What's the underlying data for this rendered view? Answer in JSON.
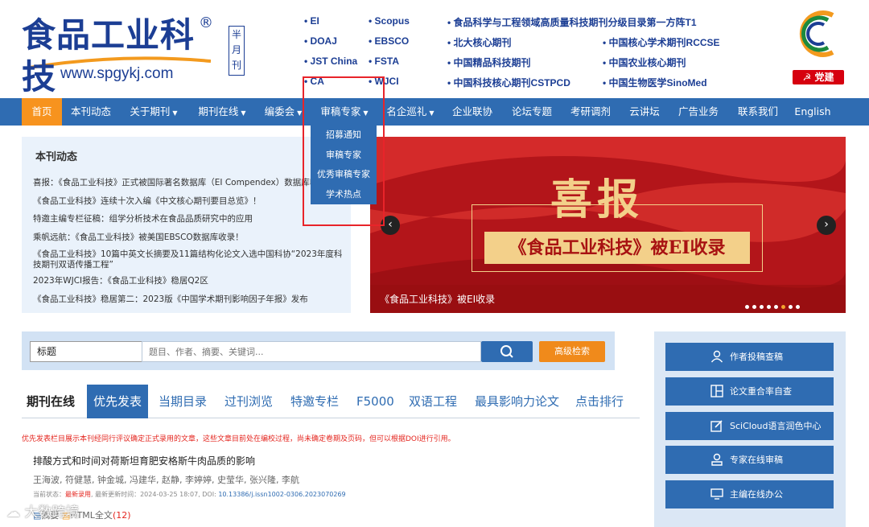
{
  "header": {
    "logo_cn": "食品工业科技",
    "logo_reg": "®",
    "logo_url": "www.spgykj.com",
    "frequency": "半月刊",
    "indexes": [
      "EI",
      "Scopus",
      "食品科学与工程领域高质量科技期刊分级目录第一方阵T1",
      "DOAJ",
      "EBSCO",
      "北大核心期刊",
      "中国核心学术期刊RCCSE",
      "JST China",
      "FSTA",
      "中国精品科技期刊",
      "中国农业核心期刊",
      "CA",
      "WJCI",
      "中国科技核心期刊CSTPCD",
      "中国生物医学SinoMed"
    ],
    "badge_2023": "中国精品科技期刊",
    "party_label": "党建"
  },
  "nav": {
    "items": [
      "首页",
      "本刊动态",
      "关于期刊",
      "期刊在线",
      "编委会",
      "审稿专家",
      "名企巡礼",
      "企业联协",
      "论坛专题",
      "考研调剂",
      "云讲坛",
      "广告业务",
      "联系我们",
      "English"
    ],
    "active": "首页",
    "dropdown": [
      "招募通知",
      "审稿专家",
      "优秀审稿专家",
      "学术热点"
    ]
  },
  "news": {
    "title": "本刊动态",
    "items": [
      "喜报：《食品工业科技》正式被国际著名数据库（EI Compendex）数据库收录",
      "《食品工业科技》连续十次入编《中文核心期刊要目总览》！",
      "特邀主编专栏征稿：组学分析技术在食品品质研究中的应用",
      "乘帆远航：《食品工业科技》被美国EBSCO数据库收录！",
      "《食品工业科技》10篇中英文长摘要及11篇结构化论文入选中国科协“2023年度科技期刊双语传播工程”",
      "2023年WJCI报告：《食品工业科技》稳居Q2区",
      "《食品工业科技》稳居第二：2023版《中国学术期刊影响因子年报》发布"
    ]
  },
  "banner": {
    "headline": "喜报",
    "subline": "《食品工业科技》被EI收录",
    "caption": "《食品工业科技》被EI收录",
    "dots_total": 8,
    "dots_active_index": 5
  },
  "search": {
    "field": "标题",
    "placeholder": "题目、作者、摘要、关键词...",
    "advanced_label": "高级检索"
  },
  "tabs": {
    "section_label": "期刊在线",
    "items": [
      "优先发表",
      "当期目录",
      "过刊浏览",
      "特邀专栏",
      "F5000",
      "双语工程",
      "最具影响力论文",
      "点击排行"
    ],
    "active": "优先发表"
  },
  "notice": "优先发表栏目展示本刊经同行评议确定正式录用的文章，这些文章目前处在编校过程，尚未确定卷期及页码，但可以根据DOI进行引用。",
  "article": {
    "title": "排酸方式和时间对荷斯坦育肥安格斯牛肉品质的影响",
    "authors": "王海波, 符健慧, 钟金城, 冯建华, 赵静, 李婷婷, 史莹华, 张兴隆, 李航",
    "status_label": "当前状态：",
    "status_value": "最新录用",
    "updated_label": ", 最新更新时间：",
    "updated_value": "2024-03-25 18:07",
    "doi_label": ", DOI: ",
    "doi_value": "10.13386/j.issn1002-0306.2023070269",
    "links_prefix": "摘要",
    "html_label": "HTML全文",
    "html_count": "(12)"
  },
  "side": {
    "buttons": [
      "作者投稿查稿",
      "论文重合率自查",
      "SciCloud语言润色中心",
      "专家在线审稿",
      "主编在线办公"
    ]
  },
  "watermark": "大数跨境",
  "colors": {
    "brand_blue": "#2f6cb2",
    "accent_orange": "#f7931e",
    "red": "#e4261f",
    "banner_red": "#c81c1c"
  }
}
